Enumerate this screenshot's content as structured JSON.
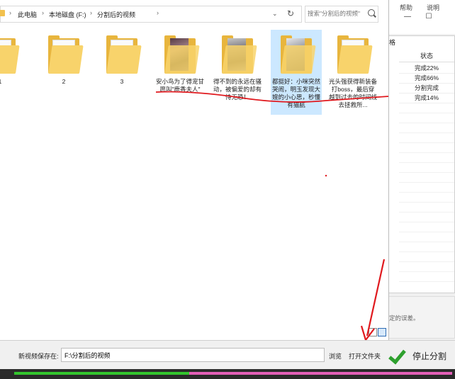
{
  "background_app": {
    "menu_items": [
      "帮助",
      "说明"
    ],
    "panel_tab": "格",
    "status_header": "状态",
    "status_rows": [
      "完成22%",
      "完成66%",
      "分割完成",
      "完成14%"
    ],
    "hint_text": "定的误差。"
  },
  "dialog": {
    "breadcrumbs": [
      "此电脑",
      "本地磁盘 (F:)",
      "分割后的视频"
    ],
    "search_placeholder": "搜索\"分割后的视频\"",
    "folders": [
      {
        "label": "1",
        "thumb": "none"
      },
      {
        "label": "2",
        "thumb": "none"
      },
      {
        "label": "3",
        "thumb": "none"
      },
      {
        "label": "安小鸟为了得宠甘愿叫\"鹿香夫人\"",
        "thumb": "image"
      },
      {
        "label": "得不到的永远在骚动，被偏爱的却有恃无恐！",
        "thumb": "image"
      },
      {
        "label": "都挺好：小咪突然哭闹，明玉发现大嫂的小心思，秒懂有猫腻",
        "thumb": "image",
        "selected": true
      },
      {
        "label": "光头强获得新装备打boss，最后穿越到过去的时间线去拯救所...",
        "thumb": "none"
      }
    ]
  },
  "bottom_bar": {
    "save_label": "新视频保存在:",
    "save_path": "F:\\分割后的视频",
    "browse_label": "浏览",
    "open_folder_label": "打开文件夹",
    "stop_label": "停止分割"
  },
  "progress": {
    "value": 0.4
  },
  "colors": {
    "annotation_red": "#e0191e",
    "progress_done": "#33c52e",
    "progress_remaining": "#e35fb7",
    "folder_yellow": "#f8d36b",
    "selection_blue": "#cce8ff"
  }
}
